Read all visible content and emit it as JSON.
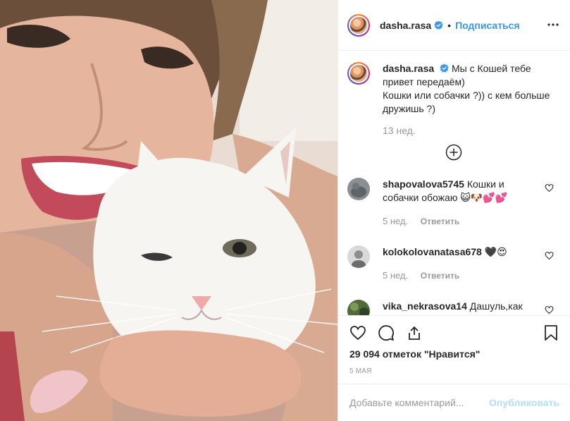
{
  "post": {
    "username": "dasha.rasa",
    "follow_label": "Подписаться",
    "dot": "•",
    "caption_line1": "Мы с Кошей тебе привет передаём)",
    "caption_line2": "Кошки или собачки ?)) с кем больше дружишь ?)",
    "caption_time": "13 нед.",
    "likes": "29 094 отметок \"Нравится\"",
    "date": "5 мая",
    "comment_placeholder": "Добавьте комментарий...",
    "publish_label": "Опубликовать"
  },
  "comments": [
    {
      "username": "shapovalova5745",
      "text": "Кошки и собачки обожаю 😺🐶💕💕",
      "time": "5 нед.",
      "reply": "Ответить"
    },
    {
      "username": "kolokolovanatasa678",
      "text": "🖤😍",
      "time": "5 нед.",
      "reply": "Ответить"
    },
    {
      "username": "vika_nekrasova14",
      "text": "Дашуль,как"
    }
  ],
  "icons": {
    "verified": "verified-badge-icon",
    "more": "more-options-icon",
    "load_more": "plus-circle-icon",
    "like": "heart-icon",
    "comment": "comment-icon",
    "share": "share-icon",
    "save": "bookmark-icon"
  },
  "colors": {
    "accent": "#3897f0",
    "muted": "#999999",
    "publish_disabled": "#b2dffc",
    "border": "#efefef"
  }
}
